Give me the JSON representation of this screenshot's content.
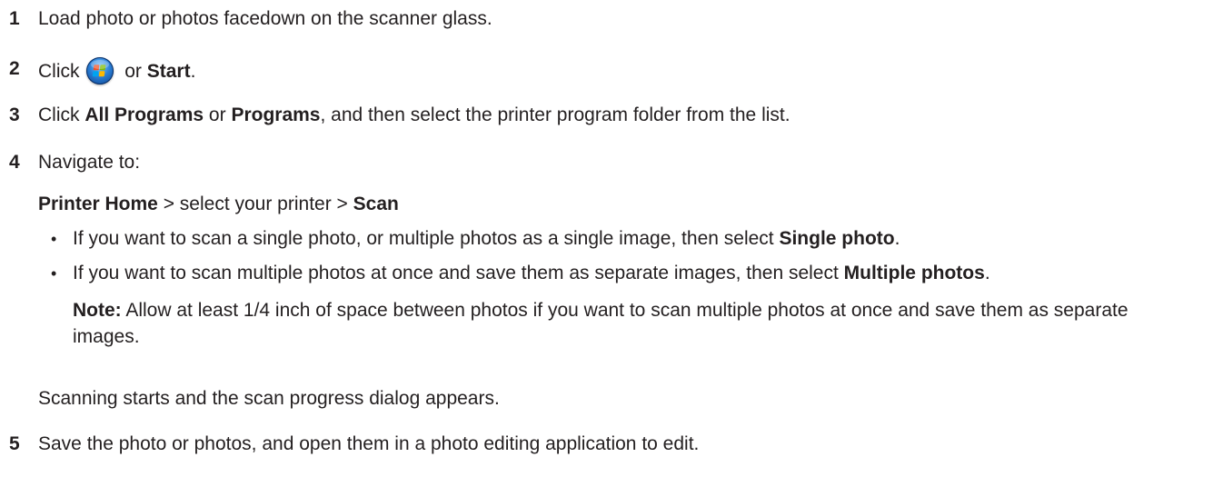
{
  "steps": [
    {
      "num": "1",
      "text": "Load photo or photos facedown on the scanner glass."
    },
    {
      "num": "2",
      "pre": "Click",
      "icon": "windows-start-icon",
      "mid": "or",
      "bold": "Start",
      "post": "."
    },
    {
      "num": "3",
      "pre": "Click",
      "bold1": "All Programs",
      "mid": "or",
      "bold2": "Programs",
      "post": ", and then select the printer program folder from the list."
    },
    {
      "num": "4",
      "text": "Navigate to:"
    },
    {
      "num": "5",
      "text": "Save the photo or photos, and open them in a photo editing application to edit."
    }
  ],
  "navigate_path": {
    "bold1": "Printer Home",
    "mid": " > select your printer > ",
    "bold2": "Scan"
  },
  "bullets": [
    {
      "text": "If you want to scan a single photo, or multiple photos as a single image, then select ",
      "bold": "Single photo",
      "post": "."
    },
    {
      "text": "If you want to scan multiple photos at once and save them as separate images, then select ",
      "bold": "Multiple photos",
      "post": "."
    }
  ],
  "note": {
    "label": "Note:",
    "text": " Allow at least 1/4 inch of space between photos if you want to scan multiple photos at once and save them as separate images."
  },
  "scanning_text": "Scanning starts and the scan progress dialog appears.",
  "bullet_glyph": "•"
}
